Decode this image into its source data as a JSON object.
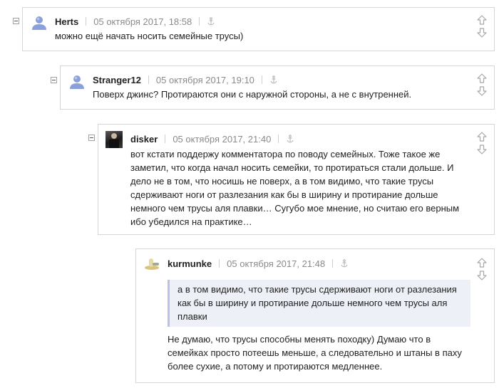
{
  "comments": [
    {
      "username": "Herts",
      "date": "05 октября 2017, 18:58",
      "avatar": "default-user-avatar",
      "text": "можно ещё начать носить семейные трусы)"
    },
    {
      "username": "Stranger12",
      "date": "05 октября 2017, 19:10",
      "avatar": "default-user-avatar",
      "text": "Поверх джинс? Протираются они с наружной стороны, а не с внутренней."
    },
    {
      "username": "disker",
      "date": "05 октября 2017, 21:40",
      "avatar": "photo-avatar",
      "text": "вот кстати поддержу комментатора по поводу семейных. Тоже такое же заметил, что когда начал носить семейки, то протираться стали дольше. И дело не в том, что носишь не поверх, а в том видимо, что такие трусы сдерживают ноги от разлезания как бы в ширину и протирание дольше немного чем трусы аля плавки… Сугубо мое мнение, но считаю его верным ибо убедился на практике…"
    },
    {
      "username": "kurmunke",
      "date": "05 октября 2017, 21:48",
      "avatar": "image-avatar",
      "quote": "а в том видимо, что такие трусы сдерживают ноги от разлезания как бы в ширину и протирание дольше немного чем трусы аля плавки",
      "text": "Не думаю, что трусы способны менять походку) Думаю что в семейках просто потеешь меньше, а следовательно и штаны в паху более сухие, а потому и протираются медленнее."
    }
  ],
  "icons": {
    "collapse": "collapse-minus-icon",
    "anchor": "anchor-link-icon",
    "upvote": "arrow-up-icon",
    "downvote": "arrow-down-icon"
  },
  "colors": {
    "border": "#d6d6d6",
    "date": "#8a8a8a",
    "quote_bg": "#eef0f8",
    "quote_border": "#b9c2e6"
  }
}
